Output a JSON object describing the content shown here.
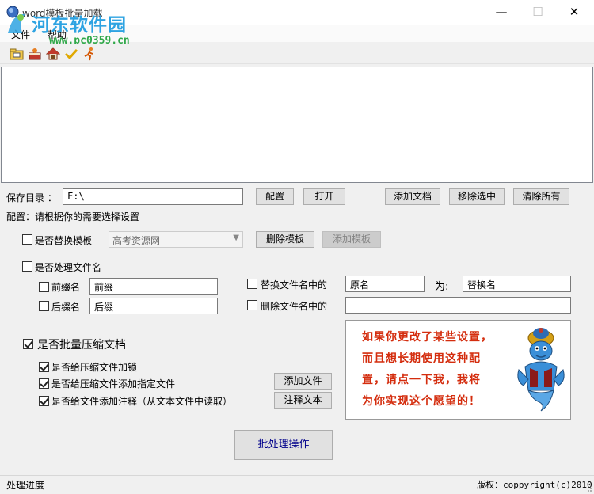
{
  "window": {
    "title": "word模板批量加载",
    "minimize_glyph": "—",
    "maximize_glyph": "☐",
    "close_glyph": "✕"
  },
  "watermark": {
    "name": "河东软件园",
    "url": "www.pc0359.cn"
  },
  "menu": {
    "items": [
      "文件",
      "帮助"
    ]
  },
  "toolbar": {
    "icons": [
      "folder-icon",
      "cake-icon",
      "home-icon",
      "checkmark-icon",
      "runner-icon"
    ]
  },
  "save": {
    "label": "保存目录 ：",
    "path": "F:\\",
    "config_btn": "配置",
    "open_btn": "打开",
    "add_doc_btn": "添加文档",
    "remove_sel_btn": "移除选中",
    "clear_all_btn": "清除所有"
  },
  "config": {
    "heading": "配置：请根据你的需要选择设置",
    "replace_template": {
      "label": "是否替换模板",
      "checked": false,
      "selected": "高考资源网",
      "delete_btn": "删除模板",
      "add_btn": "添加模板"
    },
    "process_filename": {
      "label": "是否处理文件名",
      "checked": false,
      "prefix_label": "前缀名",
      "prefix_value": "前缀",
      "suffix_label": "后缀名",
      "suffix_value": "后缀",
      "replace_label": "替换文件名中的",
      "replace_from": "原名",
      "as_label": "为:",
      "replace_to": "替换名",
      "delete_label": "删除文件名中的",
      "delete_value": ""
    },
    "compress": {
      "label": "是否批量压缩文档",
      "checked": true,
      "lock_label": "是否给压缩文件加锁",
      "lock_checked": true,
      "addfile_label": "是否给压缩文件添加指定文件",
      "addfile_checked": true,
      "comment_label": "是否给文件添加注释（从文本文件中读取）",
      "comment_checked": true,
      "add_file_btn": "添加文件",
      "comment_text_btn": "注释文本"
    }
  },
  "promo": {
    "lines": [
      "如果你更改了某些设置，",
      "而且想长期使用这种配",
      "置，请点一下我，我将",
      "为你实现这个愿望的！"
    ]
  },
  "actions": {
    "batch_btn": "批处理操作"
  },
  "status": {
    "progress_label": "处理进度",
    "copyright": "版权：coppyright(c)2010"
  },
  "colors": {
    "promo_text": "#d42d0e",
    "batch_text": "#00008b",
    "watermark_name": "#2ea3e2",
    "watermark_url": "#30a84a"
  }
}
